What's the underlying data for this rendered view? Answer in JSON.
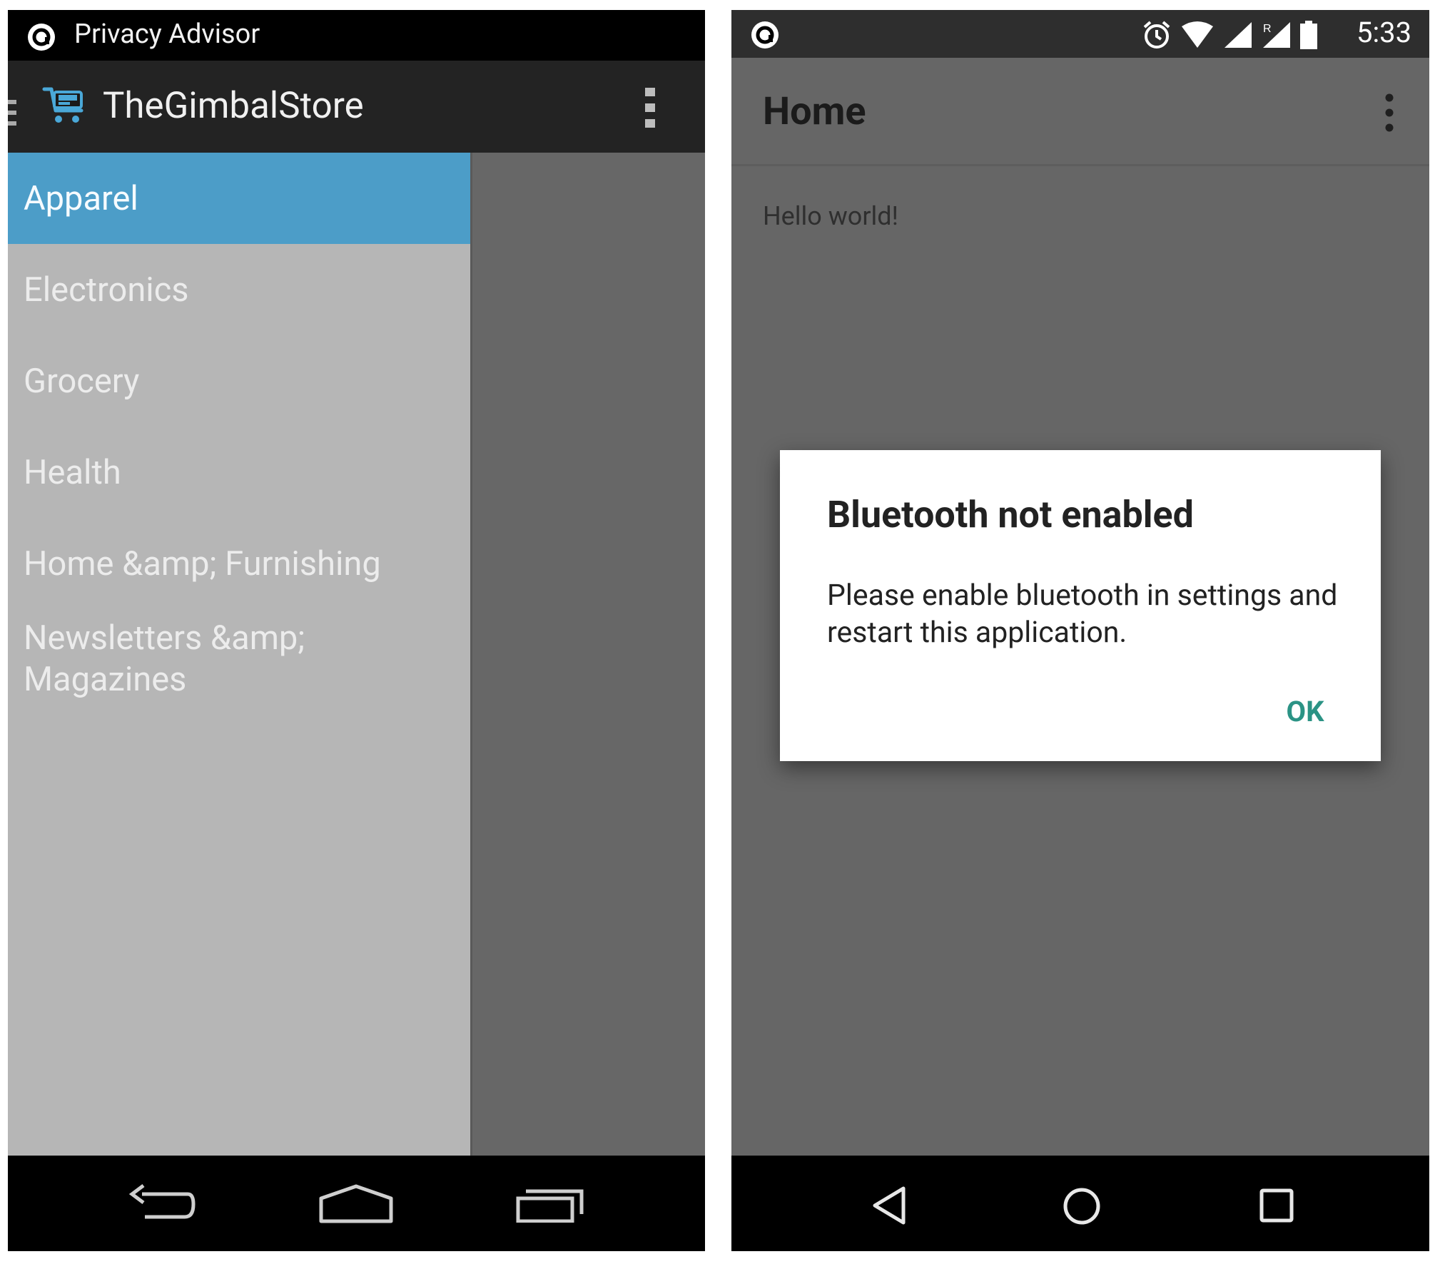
{
  "left_screen": {
    "status_bar": {
      "app_icon": "privacy-advisor-icon",
      "app_name": "Privacy Advisor"
    },
    "action_bar": {
      "icon": "shopping-cart-icon",
      "title": "TheGimbalStore",
      "overflow_icon": "overflow-menu-icon"
    },
    "drawer": {
      "items": [
        {
          "label": "Apparel",
          "selected": true
        },
        {
          "label": "Electronics",
          "selected": false
        },
        {
          "label": "Grocery",
          "selected": false
        },
        {
          "label": "Health",
          "selected": false
        },
        {
          "label": "Home &amp; Furnishing",
          "selected": false
        },
        {
          "label_line1": "Newsletters &amp;",
          "label_line2": "Magazines",
          "selected": false
        }
      ]
    },
    "nav_bar": {
      "back_icon": "back-arrow-icon",
      "home_icon": "home-icon",
      "recents_icon": "recent-apps-icon"
    },
    "colors": {
      "selected_item": "#4c9dc8",
      "drawer_bg": "#b6b6b6",
      "action_bar": "#232323"
    }
  },
  "right_screen": {
    "status_bar": {
      "app_icon": "privacy-advisor-icon",
      "icons": [
        "alarm-icon",
        "wifi-icon",
        "signal-icon",
        "roaming-signal-icon",
        "battery-icon"
      ],
      "time": "5:33"
    },
    "action_bar": {
      "title": "Home",
      "overflow_icon": "overflow-menu-icon"
    },
    "content": {
      "hello_text": "Hello world!"
    },
    "dialog": {
      "title": "Bluetooth not enabled",
      "message": "Please enable bluetooth in settings and restart this application.",
      "ok_label": "OK"
    },
    "nav_bar": {
      "back_icon": "back-triangle-icon",
      "home_icon": "home-circle-icon",
      "recents_icon": "recents-square-icon"
    },
    "colors": {
      "accent": "#2b9385",
      "background": "#666666"
    }
  }
}
